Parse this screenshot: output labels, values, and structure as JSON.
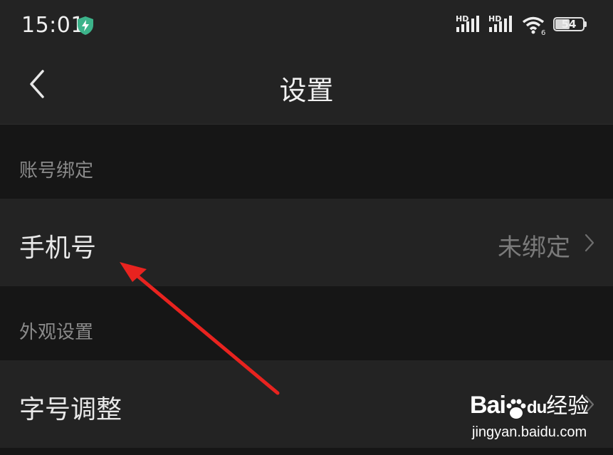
{
  "status_bar": {
    "time": "15:01",
    "signal1_label": "HD",
    "signal2_label": "HD",
    "wifi_badge": "6",
    "battery_level": "54"
  },
  "nav": {
    "title": "设置"
  },
  "sections": [
    {
      "header": "账号绑定",
      "rows": [
        {
          "label": "手机号",
          "value": "未绑定"
        }
      ]
    },
    {
      "header": "外观设置",
      "rows": [
        {
          "label": "字号调整",
          "value": ""
        }
      ]
    }
  ],
  "watermark": {
    "logo_text_a": "Bai",
    "logo_text_b": "du",
    "logo_cn": "经验",
    "url": "jingyan.baidu.com"
  },
  "colors": {
    "background": "#161616",
    "panel": "#232323",
    "text_primary": "#e8e8e8",
    "text_secondary": "#8a8a8a",
    "annotation_arrow": "#e8231f"
  },
  "icons": {
    "shield": "shield-bolt-icon",
    "back": "chevron-left-icon",
    "row_chevron": "chevron-right-icon",
    "wifi": "wifi-icon",
    "battery": "battery-icon"
  }
}
